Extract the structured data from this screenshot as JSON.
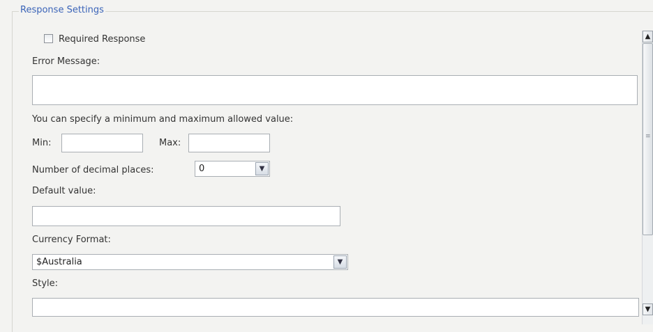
{
  "section": {
    "legend": "Response Settings"
  },
  "required_response": {
    "label": "Required Response",
    "checked": false
  },
  "error_message": {
    "label": "Error Message:",
    "value": ""
  },
  "range": {
    "hint": "You can specify a minimum and maximum allowed value:",
    "min_label": "Min:",
    "min_value": "",
    "max_label": "Max:",
    "max_value": ""
  },
  "decimals": {
    "label": "Number of decimal places:",
    "value": "0"
  },
  "default_value": {
    "label": "Default value:",
    "value": ""
  },
  "currency": {
    "label": "Currency Format:",
    "value": "$Australia"
  },
  "style": {
    "label": "Style:",
    "value": ""
  },
  "icons": {
    "dropdown": "chevron-down-icon",
    "scroll_up": "arrow-up-icon",
    "scroll_down": "arrow-down-icon"
  }
}
